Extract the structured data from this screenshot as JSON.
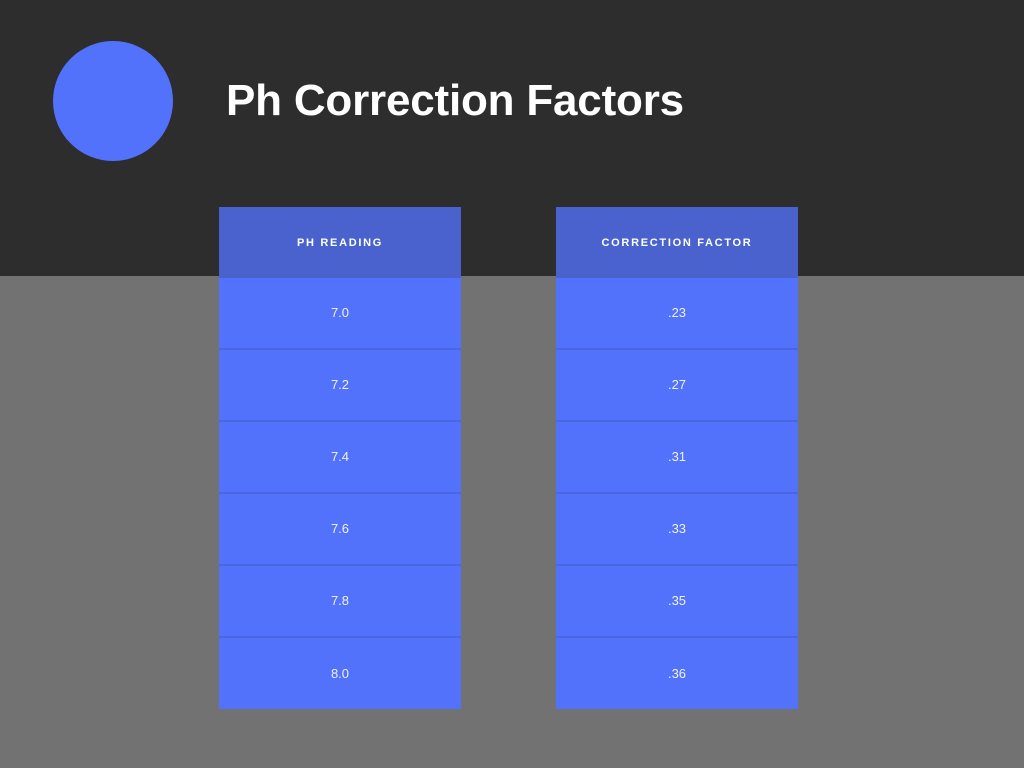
{
  "slide": {
    "title": "Ph Correction Factors",
    "logo_shape": "circle",
    "background_top_color": "#2d2d2d",
    "background_bottom_color": "#727272",
    "accent_color": "#5272fb",
    "header_cell_color": "#4a62ce",
    "divider_color": "#4a66e0",
    "title_color": "#ffffff"
  },
  "table": {
    "columns": [
      {
        "header": "PH READING"
      },
      {
        "header": "CORRECTION FACTOR"
      }
    ],
    "rows": [
      {
        "ph_reading": "7.0",
        "correction_factor": ".23"
      },
      {
        "ph_reading": "7.2",
        "correction_factor": ".27"
      },
      {
        "ph_reading": "7.4",
        "correction_factor": ".31"
      },
      {
        "ph_reading": "7.6",
        "correction_factor": ".33"
      },
      {
        "ph_reading": "7.8",
        "correction_factor": ".35"
      },
      {
        "ph_reading": "8.0",
        "correction_factor": ".36"
      }
    ]
  },
  "chart_data": {
    "type": "table",
    "title": "Ph Correction Factors",
    "columns": [
      "PH READING",
      "CORRECTION FACTOR"
    ],
    "categories": [
      "7.0",
      "7.2",
      "7.4",
      "7.6",
      "7.8",
      "8.0"
    ],
    "series": [
      {
        "name": "CORRECTION FACTOR",
        "values": [
          0.23,
          0.27,
          0.31,
          0.33,
          0.35,
          0.36
        ]
      }
    ],
    "xlabel": "PH READING",
    "ylabel": "CORRECTION FACTOR",
    "grid": false,
    "legend": "none"
  }
}
